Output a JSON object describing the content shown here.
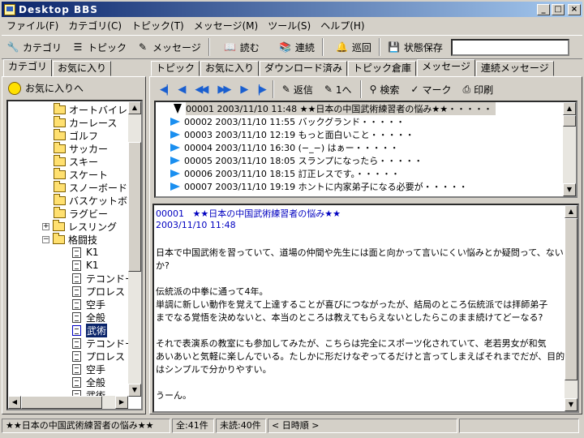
{
  "window": {
    "title": "Desktop BBS",
    "min": "_",
    "max": "□",
    "close": "×"
  },
  "menu": [
    "ファイル(F)",
    "カテゴリ(C)",
    "トピック(T)",
    "メッセージ(M)",
    "ツール(S)",
    "ヘルプ(H)"
  ],
  "toolbar": {
    "category": "カテゴリ",
    "topic": "トピック",
    "message": "メッセージ",
    "read": "読む",
    "continuous": "連続",
    "patrol": "巡回",
    "save_state": "状態保存"
  },
  "left_tabs": [
    "カテゴリ",
    "お気に入り"
  ],
  "favorites_label": "お気に入りへ",
  "tree": {
    "folders": [
      "オートバイレー",
      "カーレース",
      "ゴルフ",
      "サッカー",
      "スキー",
      "スケート",
      "スノーボード",
      "バスケットボー",
      "ラグビー",
      "レスリング",
      "格闘技"
    ],
    "topics": [
      "K1",
      "K1",
      "テコンドー",
      "プロレス",
      "空手",
      "全般",
      "武術",
      "テコンドー",
      "プロレス",
      "空手",
      "全般",
      "武術"
    ]
  },
  "right_tabs": [
    "トピック",
    "お気に入り",
    "ダウンロード済み",
    "トピック倉庫",
    "メッセージ",
    "連続メッセージ"
  ],
  "nav": {
    "reply": "返信",
    "first": "1へ",
    "search": "検索",
    "mark": "マーク",
    "print": "印刷"
  },
  "messages": [
    {
      "no": "00001",
      "date": "2003/11/10 11:48",
      "subject": "★★日本の中国武術練習者の悩み★★・・・・・"
    },
    {
      "no": "00002",
      "date": "2003/11/10 11:55",
      "subject": "バックグランド・・・・・"
    },
    {
      "no": "00003",
      "date": "2003/11/10 12:19",
      "subject": "もっと面白いこと・・・・・"
    },
    {
      "no": "00004",
      "date": "2003/11/10 16:30",
      "subject": "(−_−) はぁー・・・・・"
    },
    {
      "no": "00005",
      "date": "2003/11/10 18:05",
      "subject": "スランプになったら・・・・・"
    },
    {
      "no": "00006",
      "date": "2003/11/10 18:15",
      "subject": "訂正レスです。・・・・・"
    },
    {
      "no": "00007",
      "date": "2003/11/10 19:19",
      "subject": "ホントに内家弟子になる必要が・・・・・"
    }
  ],
  "body": {
    "header_no": "00001",
    "header_title": "★★日本の中国武術練習者の悩み★★",
    "header_date": "2003/11/10 11:48",
    "lines": [
      "日本で中国武術を習っていて、道場の仲間や先生には面と向かって言いにくい悩みとか疑問って、ない",
      "か?",
      "",
      "伝統派の中拳に通って4年。",
      "単調に新しい動作を覚えて上達することが喜びにつながったが、結局のところ伝統派では拝師弟子",
      "までなる覚悟を決めないと、本当のところは教えてもらえないとしたらこのまま続けてどーなる?",
      "",
      "それで表演系の教室にも参加してみたが、こちらは完全にスポーツ化されていて、老若男女が和気",
      "あいあいと気軽に楽しんでいる。たしかに形だけなぞってるだけと言ってしまえばそれまでだが、目的",
      "はシンプルで分かりやすい。",
      "",
      "うーん。"
    ]
  },
  "status": {
    "topic": "★★日本の中国武術練習者の悩み★★",
    "total": "全:41件",
    "unread": "未読:40件",
    "sort": "< 日時順 >"
  }
}
